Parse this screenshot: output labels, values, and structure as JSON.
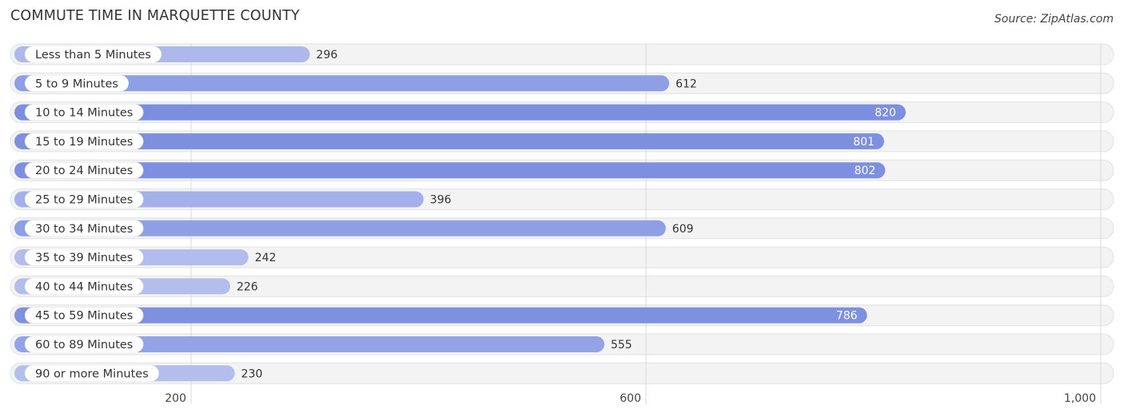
{
  "chart_data": {
    "type": "bar",
    "orientation": "horizontal",
    "title": "COMMUTE TIME IN MARQUETTE COUNTY",
    "source": "Source: ZipAtlas.com",
    "categories": [
      "Less than 5 Minutes",
      "5 to 9 Minutes",
      "10 to 14 Minutes",
      "15 to 19 Minutes",
      "20 to 24 Minutes",
      "25 to 29 Minutes",
      "30 to 34 Minutes",
      "35 to 39 Minutes",
      "40 to 44 Minutes",
      "45 to 59 Minutes",
      "60 to 89 Minutes",
      "90 or more Minutes"
    ],
    "values": [
      296,
      612,
      820,
      801,
      802,
      396,
      609,
      242,
      226,
      786,
      555,
      230
    ],
    "value_labels": [
      "296",
      "612",
      "820",
      "801",
      "802",
      "396",
      "609",
      "242",
      "226",
      "786",
      "555",
      "230"
    ],
    "xticks": [
      200,
      600,
      1000
    ],
    "xtick_labels": [
      "200",
      "600",
      "1,000"
    ],
    "xlim": [
      0,
      1000
    ],
    "grid": true,
    "xlabel": "",
    "ylabel": "",
    "colors": {
      "low": "#b4beed",
      "high": "#7b8ee0",
      "track": "#f2f2f2"
    }
  }
}
